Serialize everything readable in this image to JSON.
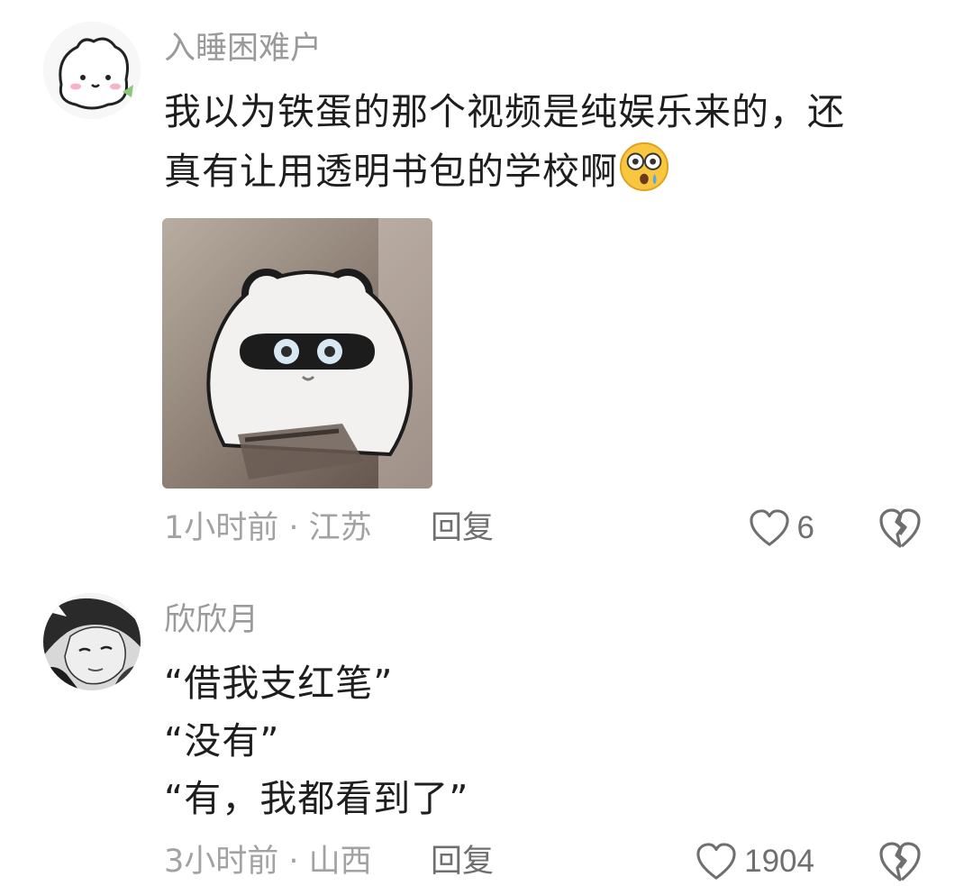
{
  "comments": [
    {
      "username": "入睡困难户",
      "text_lines": [
        "我以为铁蛋的那个视频是纯娱乐来的，还",
        "真有让用透明书包的学校啊"
      ],
      "emoji": "astonished-face-icon",
      "has_sticker": true,
      "time_location": "1小时前 · 江苏",
      "reply_label": "回复",
      "like_count": "6"
    },
    {
      "username": "欣欣月",
      "text_lines": [
        "“借我支红笔”",
        "“没有”",
        "“有，我都看到了”"
      ],
      "time_location": "3小时前 · 山西",
      "reply_label": "回复",
      "like_count": "1904"
    }
  ],
  "colors": {
    "username": "#9a9a9a",
    "meta": "#a2a2a2",
    "action": "#6f6f6f",
    "text": "#1e1e1e"
  }
}
